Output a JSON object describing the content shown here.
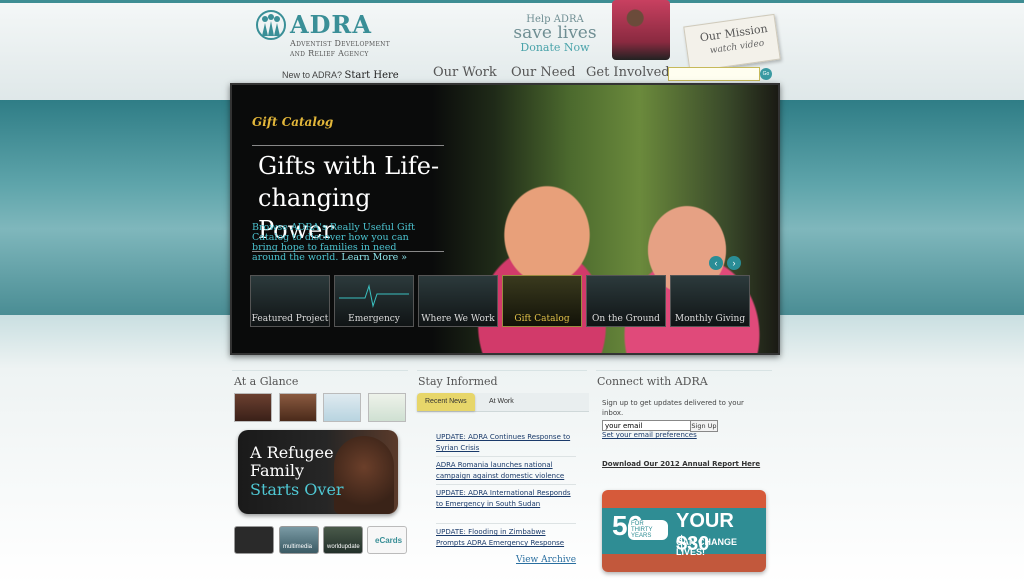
{
  "header": {
    "logo_word": "ADRA",
    "logo_sub_line1": "Adventist Development",
    "logo_sub_line2": "and Relief Agency",
    "new_prefix": "New to ADRA?",
    "new_link": "Start Here",
    "save_line1": "Help ADRA",
    "save_line2": "save lives",
    "save_line3": "Donate Now",
    "mission_line1": "Our Mission",
    "mission_line2": "watch video"
  },
  "nav": {
    "items": [
      "Our Work",
      "Our Need",
      "Get Involved"
    ],
    "search_value": "",
    "go_label": "Go"
  },
  "hero": {
    "kicker": "Gift Catalog",
    "title": "Gifts with Life-changing Power",
    "text": "Browse ADRA's Really Useful Gift Catalog to discover how you can bring hope to families in need around the world.",
    "learn_more": "Learn More »",
    "prev_icon": "chevron-left-icon",
    "next_icon": "chevron-right-icon",
    "thumbs": [
      "Featured Project",
      "Emergency",
      "Where We Work",
      "Gift Catalog",
      "On the Ground",
      "Monthly Giving"
    ],
    "active_thumb": "Gift Catalog"
  },
  "glance": {
    "title": "At a Glance",
    "refugee_line1": "A Refugee",
    "refugee_line2": "Family",
    "refugee_line3": "Starts Over",
    "tiles": [
      "",
      "multimedia",
      "worldupdate",
      "eCards"
    ]
  },
  "informed": {
    "title": "Stay Informed",
    "tabs": [
      "Recent News",
      "At Work"
    ],
    "news": [
      "UPDATE: ADRA Continues Response to Syrian Crisis",
      "ADRA Romania launches national campaign against domestic violence",
      "UPDATE: ADRA International Responds to Emergency in South Sudan",
      "UPDATE: Flooding in Zimbabwe Prompts ADRA Emergency Response"
    ],
    "archive": "View Archive"
  },
  "connect": {
    "title": "Connect with ADRA",
    "signup_text": "Sign up to get updates delivered to your inbox.",
    "email_value": "your email",
    "signup_button": "Sign Up",
    "prefs_link": "Set your email preferences",
    "report_link": "Download Our 2012 Annual Report Here",
    "promo_number": "50",
    "promo_years": "FOR THIRTY YEARS",
    "promo_big": "YOUR $30",
    "promo_small": "CAN CHANGE LIVES!"
  },
  "colors": {
    "brand_teal": "#3a8f97",
    "gold": "#e3b73a",
    "link_blue": "#1a3a6a"
  }
}
